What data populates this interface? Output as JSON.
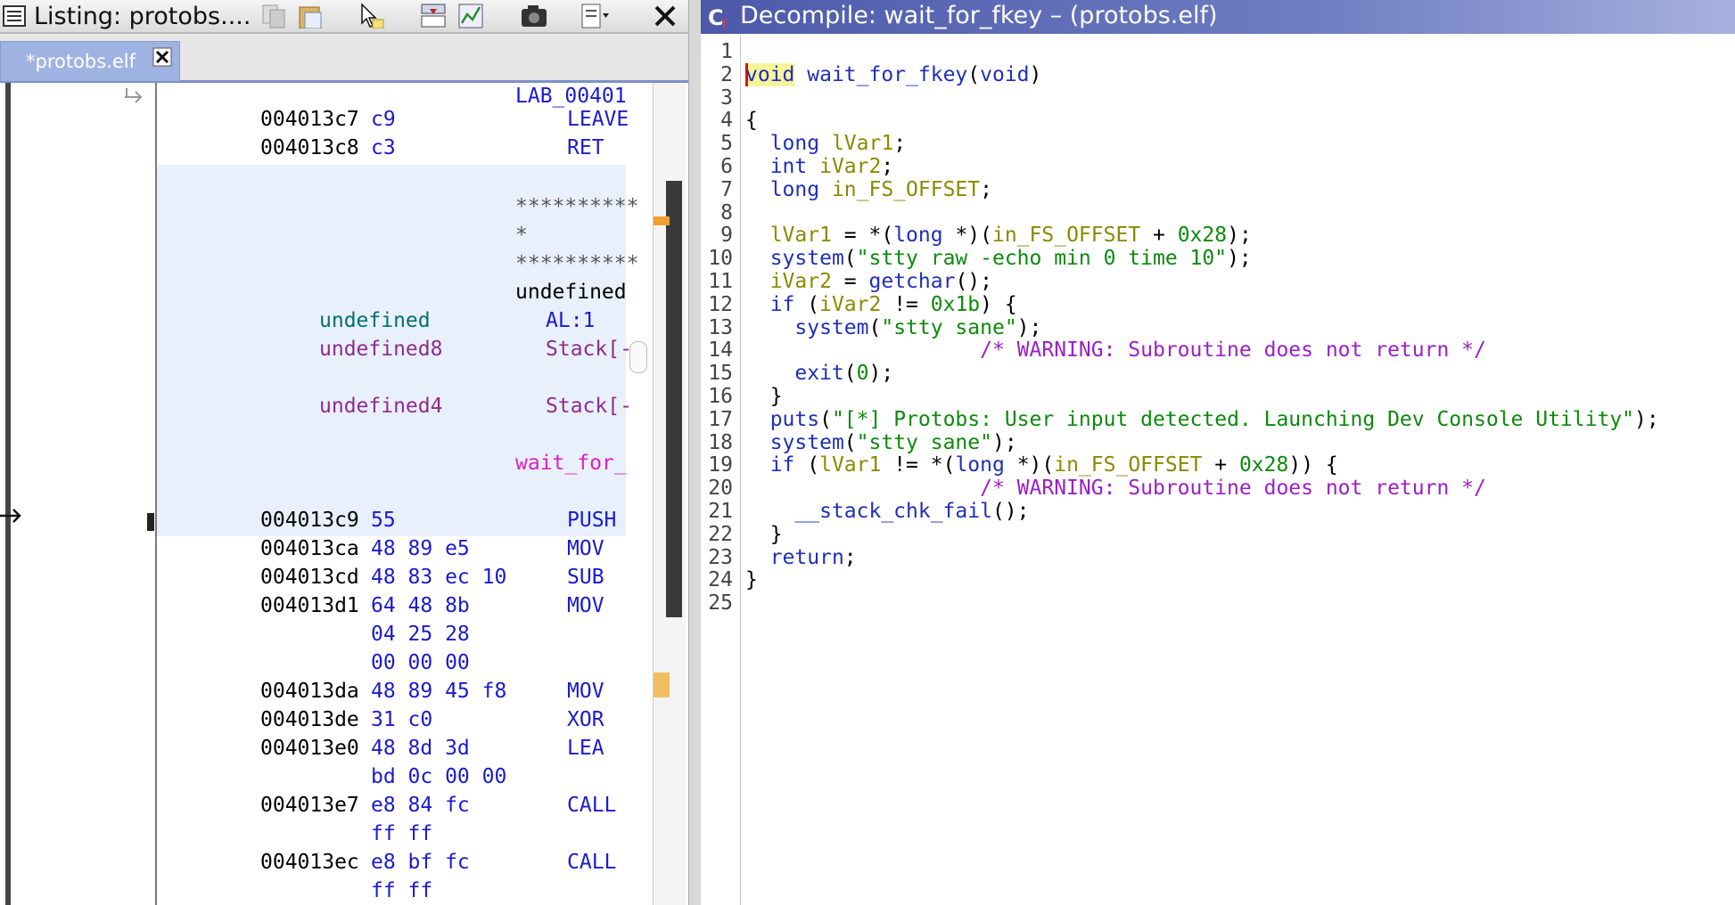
{
  "listing": {
    "title": "Listing:  protobs....",
    "tab_label": "*protobs.elf",
    "rows": [
      {
        "addr": "",
        "bytes": "",
        "mnem": "LAB_00401",
        "kind": "label"
      },
      {
        "addr": "004013c7",
        "bytes": "c9",
        "mnem": "LEAVE"
      },
      {
        "addr": "004013c8",
        "bytes": "c3",
        "mnem": "RET"
      },
      {
        "stars1": "**********"
      },
      {
        "stars2": "*"
      },
      {
        "stars3": "**********"
      },
      {
        "sig": "undefined"
      },
      {
        "param_type": "undefined",
        "param_loc": "AL:1"
      },
      {
        "param_type": "undefined8",
        "param_loc": "Stack[-"
      },
      {
        "param_type": "undefined4",
        "param_loc": "Stack[-"
      },
      {
        "fn_label": "wait_for_"
      },
      {
        "addr": "004013c9",
        "bytes": "55",
        "mnem": "PUSH"
      },
      {
        "addr": "004013ca",
        "bytes": "48 89 e5",
        "mnem": "MOV"
      },
      {
        "addr": "004013cd",
        "bytes": "48 83 ec 10",
        "mnem": "SUB"
      },
      {
        "addr": "004013d1",
        "bytes": "64 48 8b",
        "mnem": "MOV"
      },
      {
        "addr": "",
        "bytes": "04 25 28",
        "mnem": ""
      },
      {
        "addr": "",
        "bytes": "00 00 00",
        "mnem": ""
      },
      {
        "addr": "004013da",
        "bytes": "48 89 45 f8",
        "mnem": "MOV"
      },
      {
        "addr": "004013de",
        "bytes": "31 c0",
        "mnem": "XOR"
      },
      {
        "addr": "004013e0",
        "bytes": "48 8d 3d",
        "mnem": "LEA"
      },
      {
        "addr": "",
        "bytes": "bd 0c 00 00",
        "mnem": ""
      },
      {
        "addr": "004013e7",
        "bytes": "e8 84 fc",
        "mnem": "CALL"
      },
      {
        "addr": "",
        "bytes": "ff ff",
        "mnem": ""
      },
      {
        "addr": "004013ec",
        "bytes": "e8 bf fc",
        "mnem": "CALL"
      },
      {
        "addr": "",
        "bytes": "ff ff",
        "mnem": ""
      }
    ]
  },
  "decompile": {
    "title": "Decompile: wait_for_fkey –  (protobs.elf)",
    "line_numbers": [
      "1",
      "2",
      "3",
      "4",
      "5",
      "6",
      "7",
      "8",
      "9",
      "10",
      "11",
      "12",
      "13",
      "14",
      "15",
      "16",
      "17",
      "18",
      "19",
      "20",
      "21",
      "22",
      "23",
      "24",
      "25"
    ],
    "tokens": {
      "l2": [
        "void",
        " ",
        "wait_for_fkey",
        "(",
        "void",
        ")"
      ],
      "l4": [
        "{"
      ],
      "l5": [
        "  ",
        "long",
        " ",
        "lVar1",
        ";"
      ],
      "l6": [
        "  ",
        "int",
        " ",
        "iVar2",
        ";"
      ],
      "l7": [
        "  ",
        "long",
        " ",
        "in_FS_OFFSET",
        ";"
      ],
      "l9": [
        "  ",
        "lVar1",
        " = *(",
        "long",
        " *)(",
        "in_FS_OFFSET",
        " + ",
        "0x28",
        ");"
      ],
      "l10": [
        "  ",
        "system",
        "(",
        "\"stty raw -echo min 0 time 10\"",
        ");"
      ],
      "l11": [
        "  ",
        "iVar2",
        " = ",
        "getchar",
        "();"
      ],
      "l12": [
        "  ",
        "if",
        " (",
        "iVar2",
        " != ",
        "0x1b",
        ") {"
      ],
      "l13": [
        "    ",
        "system",
        "(",
        "\"stty sane\"",
        ");"
      ],
      "l14": [
        "                   ",
        "/* WARNING: Subroutine does not return */"
      ],
      "l15": [
        "    ",
        "exit",
        "(",
        "0",
        ");"
      ],
      "l16": [
        "  }"
      ],
      "l17": [
        "  ",
        "puts",
        "(",
        "\"[*] Protobs: User input detected. Launching Dev Console Utility\"",
        ");"
      ],
      "l18": [
        "  ",
        "system",
        "(",
        "\"stty sane\"",
        ");"
      ],
      "l19": [
        "  ",
        "if",
        " (",
        "lVar1",
        " != *(",
        "long",
        " *)(",
        "in_FS_OFFSET",
        " + ",
        "0x28",
        ")) {"
      ],
      "l20": [
        "                   ",
        "/* WARNING: Subroutine does not return */"
      ],
      "l21": [
        "    ",
        "__stack_chk_fail",
        "();"
      ],
      "l22": [
        "  }"
      ],
      "l23": [
        "  ",
        "return",
        ";"
      ],
      "l24": [
        "}"
      ]
    }
  },
  "colors": {
    "keyword": "#1f2fb8",
    "variable": "#8a8a00",
    "number": "#0c8a0c",
    "comment": "#9b20c8",
    "title_bar": "#4c59a9"
  },
  "icons": [
    "listing-icon",
    "copy-icon",
    "paste-icon",
    "cursor-select-icon",
    "snapshot-icon",
    "chart-icon",
    "camera-icon",
    "window-menu-icon",
    "close-icon",
    "decompile-icon",
    "tab-close-icon"
  ]
}
